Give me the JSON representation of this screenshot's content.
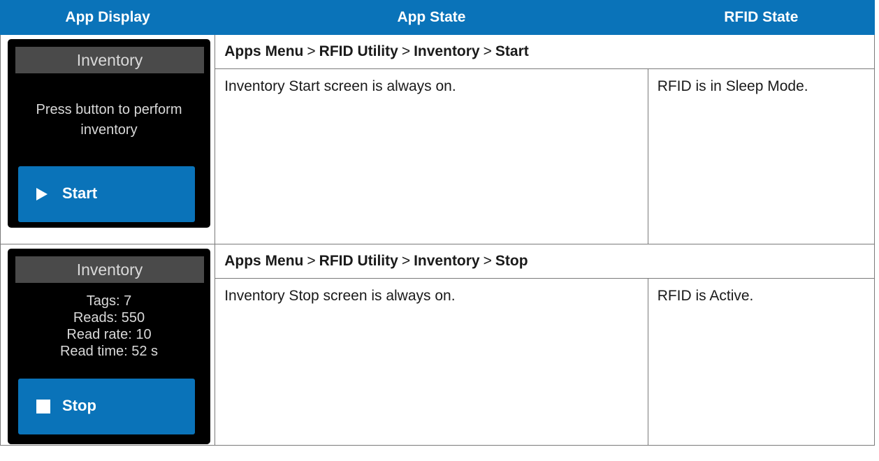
{
  "headers": [
    "App Display",
    "App State",
    "RFID State"
  ],
  "rows": [
    {
      "display": {
        "title": "Inventory",
        "body_lines": [
          "Press button to perform",
          "inventory"
        ],
        "button_label": "Start",
        "button_icon": "play-icon"
      },
      "path": [
        "Apps Menu",
        ">",
        "RFID Utility",
        ">",
        "Inventory",
        ">",
        "Start"
      ],
      "app_state": "Inventory Start screen is always on.",
      "rfid_state": "RFID is in Sleep Mode."
    },
    {
      "display": {
        "title": "Inventory",
        "body_lines": [
          "Tags: 7",
          "Reads: 550",
          "Read rate: 10",
          "Read time: 52 s"
        ],
        "button_label": "Stop",
        "button_icon": "stop-icon"
      },
      "path": [
        "Apps Menu",
        ">",
        "RFID Utility",
        ">",
        "Inventory",
        ">",
        "Stop"
      ],
      "app_state": "Inventory Stop screen is always on.",
      "rfid_state": "RFID is Active."
    }
  ],
  "colors": {
    "header_bg": "#0a73b9",
    "button_bg": "#0a73b9",
    "watch_bg": "#000000",
    "watch_header_bg": "#4a4a4a"
  }
}
